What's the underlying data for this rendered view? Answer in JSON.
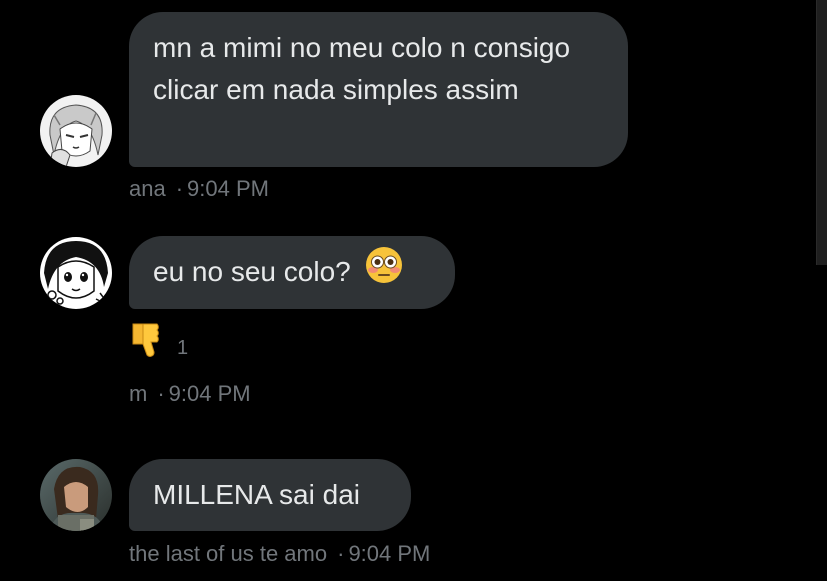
{
  "colors": {
    "background": "#000000",
    "bubble": "#2f3336",
    "text": "#e7e9ea",
    "meta": "#71767b"
  },
  "messages": [
    {
      "avatar_icon": "manga-girl-avatar",
      "text": "mn a mimi no meu colo n consigo clicar em nada simples assim",
      "sender": "ana",
      "time": "9:04 PM"
    },
    {
      "avatar_icon": "manga-character-avatar",
      "text": "eu no seu colo?",
      "emoji": "flushed-face-emoji",
      "reaction": {
        "icon": "thumbs-down-emoji",
        "count": "1"
      },
      "sender": "m",
      "time": "9:04 PM"
    },
    {
      "avatar_icon": "photo-girl-avatar",
      "text": "MILLENA sai dai",
      "sender": "the last of us te amo",
      "time": "9:04 PM"
    }
  ],
  "separator": "·"
}
